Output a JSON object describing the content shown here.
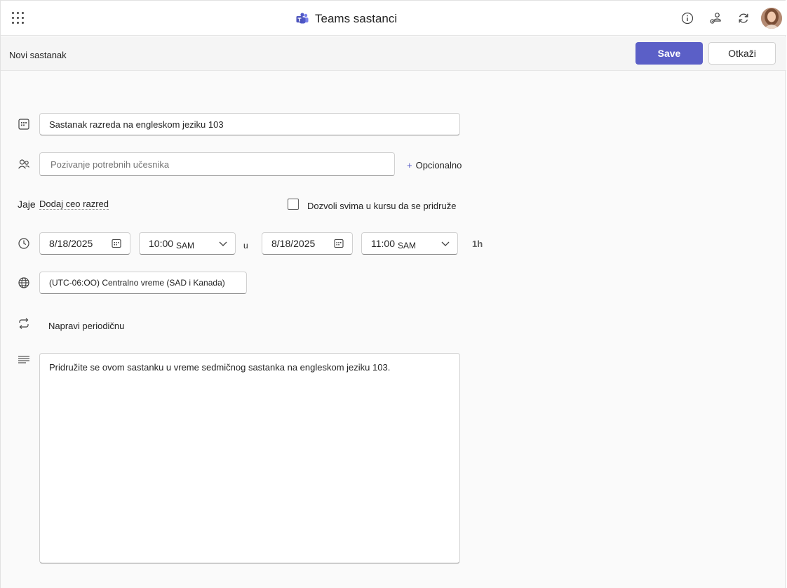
{
  "header": {
    "app_title": "Teams sastanci",
    "app_icon": "teams-logo-icon",
    "icons": [
      "waffle-icon",
      "info-icon",
      "people-settings-icon",
      "refresh-icon",
      "avatar"
    ]
  },
  "subheader": {
    "page_title": "Novi sastanak",
    "save_label": "Save",
    "cancel_label": "Otkaži"
  },
  "form": {
    "title_value": "Sastanak razreda na engleskom jeziku 103",
    "attendees_placeholder": "Pozivanje potrebnih učesnika",
    "optional_label": "Opcionalno",
    "jaje_label": "Jaje",
    "add_class_label": "Dodaj ceo razred",
    "allow_all_label": "Dozvoli svima u kursu da se pridruže",
    "start_date": "8/18/2025",
    "start_time": "10:00",
    "start_ampm": "SAM",
    "to_label": "u",
    "end_date": "8/18/2025",
    "end_time": "11:00",
    "end_ampm": "SAM",
    "duration": "1h",
    "timezone": "(UTC-06:OO) Centralno vreme (SAD i Kanada)",
    "recurrence_label": "Napravi periodičnu",
    "description": "Pridružite se ovom sastanku u vreme sedmičnog sastanka na engleskom jeziku 103."
  },
  "colors": {
    "accent": "#5b5fc7",
    "background": "#fafafa",
    "border": "#d1d1d1"
  }
}
